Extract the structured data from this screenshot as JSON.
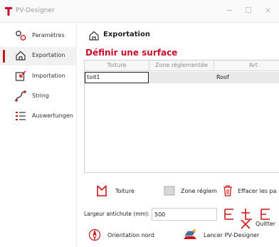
{
  "window": {
    "title": "PV-Designer",
    "minimize": "−",
    "maximize": "☐",
    "close": "×"
  },
  "sidebar": {
    "items": [
      {
        "label": "Paramètres",
        "icon": "settings-icon"
      },
      {
        "label": "Exportation",
        "icon": "home-icon",
        "active": true
      },
      {
        "label": "Importation",
        "icon": "import-icon"
      },
      {
        "label": "String",
        "icon": "string-icon"
      },
      {
        "label": "Auswertungen",
        "icon": "list-icon"
      }
    ]
  },
  "main": {
    "section_title": "Exportation",
    "heading": "Définir une surface",
    "table": {
      "columns": [
        "Toiture",
        "Zone réglementée",
        "Art"
      ],
      "rows": [
        {
          "toiture": "toit1",
          "zone": "",
          "art": "Roof"
        }
      ]
    },
    "buttons": {
      "toiture": "Toiture",
      "zone": "Zone réglem",
      "effacer": "Effacer les pa",
      "orientation": "Orientation nord",
      "lancer": "Lancer PV-Designer",
      "quitter": "Quitter"
    },
    "field": {
      "label": "Largeur antichute (mm):",
      "value": "500"
    }
  },
  "colors": {
    "accent": "#c8102e",
    "selection_bar": "#c91a1a",
    "row_bg": "#e9e9e9"
  }
}
